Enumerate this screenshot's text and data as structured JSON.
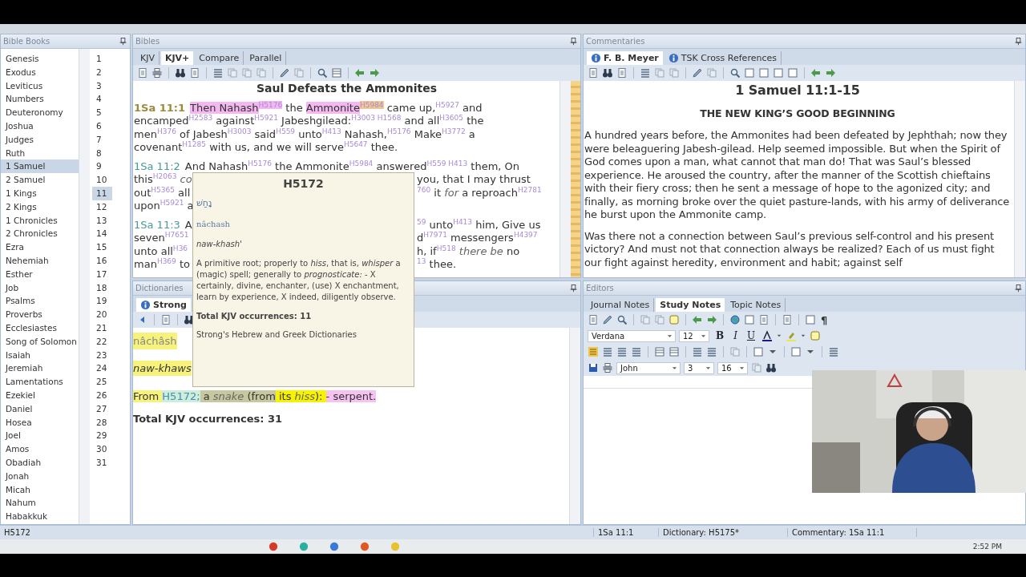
{
  "bible_books": {
    "title": "Bible Books",
    "books": [
      {
        "label": "Genesis",
        "selected": false
      },
      {
        "label": "Exodus",
        "selected": false
      },
      {
        "label": "Leviticus",
        "selected": false
      },
      {
        "label": "Numbers",
        "selected": false
      },
      {
        "label": "Deuteronomy",
        "selected": false
      },
      {
        "label": "Joshua",
        "selected": false
      },
      {
        "label": "Judges",
        "selected": false
      },
      {
        "label": "Ruth",
        "selected": false
      },
      {
        "label": "1 Samuel",
        "selected": true
      },
      {
        "label": "2 Samuel",
        "selected": false
      },
      {
        "label": "1 Kings",
        "selected": false
      },
      {
        "label": "2 Kings",
        "selected": false
      },
      {
        "label": "1 Chronicles",
        "selected": false
      },
      {
        "label": "2 Chronicles",
        "selected": false
      },
      {
        "label": "Ezra",
        "selected": false
      },
      {
        "label": "Nehemiah",
        "selected": false
      },
      {
        "label": "Esther",
        "selected": false
      },
      {
        "label": "Job",
        "selected": false
      },
      {
        "label": "Psalms",
        "selected": false
      },
      {
        "label": "Proverbs",
        "selected": false
      },
      {
        "label": "Ecclesiastes",
        "selected": false
      },
      {
        "label": "Song of Solomon",
        "selected": false
      },
      {
        "label": "Isaiah",
        "selected": false
      },
      {
        "label": "Jeremiah",
        "selected": false
      },
      {
        "label": "Lamentations",
        "selected": false
      },
      {
        "label": "Ezekiel",
        "selected": false
      },
      {
        "label": "Daniel",
        "selected": false
      },
      {
        "label": "Hosea",
        "selected": false
      },
      {
        "label": "Joel",
        "selected": false
      },
      {
        "label": "Amos",
        "selected": false
      },
      {
        "label": "Obadiah",
        "selected": false
      },
      {
        "label": "Jonah",
        "selected": false
      },
      {
        "label": "Micah",
        "selected": false
      },
      {
        "label": "Nahum",
        "selected": false
      },
      {
        "label": "Habakkuk",
        "selected": false
      }
    ],
    "chapters": [
      {
        "label": "1",
        "selected": false
      },
      {
        "label": "2",
        "selected": false
      },
      {
        "label": "3",
        "selected": false
      },
      {
        "label": "4",
        "selected": false
      },
      {
        "label": "5",
        "selected": false
      },
      {
        "label": "6",
        "selected": false
      },
      {
        "label": "7",
        "selected": false
      },
      {
        "label": "8",
        "selected": false
      },
      {
        "label": "9",
        "selected": false
      },
      {
        "label": "10",
        "selected": false
      },
      {
        "label": "11",
        "selected": true
      },
      {
        "label": "12",
        "selected": false
      },
      {
        "label": "13",
        "selected": false
      },
      {
        "label": "14",
        "selected": false
      },
      {
        "label": "15",
        "selected": false
      },
      {
        "label": "16",
        "selected": false
      },
      {
        "label": "17",
        "selected": false
      },
      {
        "label": "18",
        "selected": false
      },
      {
        "label": "19",
        "selected": false
      },
      {
        "label": "20",
        "selected": false
      },
      {
        "label": "21",
        "selected": false
      },
      {
        "label": "22",
        "selected": false
      },
      {
        "label": "23",
        "selected": false
      },
      {
        "label": "24",
        "selected": false
      },
      {
        "label": "25",
        "selected": false
      },
      {
        "label": "26",
        "selected": false
      },
      {
        "label": "27",
        "selected": false
      },
      {
        "label": "28",
        "selected": false
      },
      {
        "label": "29",
        "selected": false
      },
      {
        "label": "30",
        "selected": false
      },
      {
        "label": "31",
        "selected": false
      }
    ]
  },
  "bibles": {
    "title": "Bibles",
    "tabs": [
      {
        "label": "KJV",
        "selected": false
      },
      {
        "label": "KJV+",
        "selected": true
      },
      {
        "label": "Compare",
        "selected": false
      },
      {
        "label": "Parallel",
        "selected": false
      }
    ],
    "heading": "Saul Defeats the Ammonites",
    "verses": [
      {
        "reference": "1Sa 11:1",
        "selected": true,
        "lines": [
          {
            "runs": [
              {
                "t": "Then Nahash",
                "color": "#f4b8f0"
              },
              {
                "t": "H5176",
                "kind": "superscript",
                "color": "#f4b8f0"
              },
              {
                "t": " the "
              },
              {
                "t": "Ammonite",
                "color": "#f4b8f0"
              },
              {
                "t": "H5984",
                "kind": "superscript",
                "color": "#f0c890"
              },
              {
                "t": " came up,"
              },
              {
                "t": "H5927",
                "kind": "superscript"
              },
              {
                "t": " and"
              }
            ]
          },
          {
            "runs": [
              {
                "t": "encamped"
              },
              {
                "t": "H2583",
                "kind": "superscript"
              },
              {
                "t": " against"
              },
              {
                "t": "H5921",
                "kind": "superscript"
              },
              {
                "t": " Jabeshgilead:"
              },
              {
                "t": "H3003 H1568",
                "kind": "superscript"
              },
              {
                "t": " and all"
              },
              {
                "t": "H3605",
                "kind": "superscript"
              },
              {
                "t": " the"
              }
            ]
          },
          {
            "runs": [
              {
                "t": "men"
              },
              {
                "t": "H376",
                "kind": "superscript"
              },
              {
                "t": " of Jabesh"
              },
              {
                "t": "H3003",
                "kind": "superscript"
              },
              {
                "t": " said"
              },
              {
                "t": "H559",
                "kind": "superscript"
              },
              {
                "t": " unto"
              },
              {
                "t": "H413",
                "kind": "superscript"
              },
              {
                "t": " Nahash,"
              },
              {
                "t": "H5176",
                "kind": "superscript"
              },
              {
                "t": " Make"
              },
              {
                "t": "H3772",
                "kind": "superscript"
              },
              {
                "t": " a"
              }
            ]
          },
          {
            "runs": [
              {
                "t": "covenant"
              },
              {
                "t": "H1285",
                "kind": "superscript"
              },
              {
                "t": " with us, and we will serve"
              },
              {
                "t": "H5647",
                "kind": "superscript"
              },
              {
                "t": " thee."
              }
            ]
          }
        ]
      },
      {
        "reference": "1Sa 11:2",
        "selected": false,
        "lines": [
          {
            "runs": [
              {
                "t": "And Nahash"
              },
              {
                "t": "H5176",
                "kind": "superscript"
              },
              {
                "t": " the Ammonite"
              },
              {
                "t": "H5984",
                "kind": "superscript"
              },
              {
                "t": " answered"
              },
              {
                "t": "H559 H413",
                "kind": "superscript"
              },
              {
                "t": " them, On"
              }
            ]
          },
          {
            "runs": [
              {
                "t": "this"
              },
              {
                "t": "H2063",
                "kind": "superscript"
              },
              {
                "t": " co",
                "kind": "italic"
              }
            ],
            "runs_right": [
              {
                "t": "you, that I may thrust"
              }
            ]
          },
          {
            "runs": [
              {
                "t": "out"
              },
              {
                "t": "H5365",
                "kind": "superscript"
              },
              {
                "t": " all"
              }
            ],
            "runs_right": [
              {
                "t": "760",
                "kind": "superscript"
              },
              {
                "t": " it "
              },
              {
                "t": "for",
                "kind": "italic"
              },
              {
                "t": " a reproach"
              },
              {
                "t": "H2781",
                "kind": "superscript"
              }
            ]
          },
          {
            "runs": [
              {
                "t": "upon"
              },
              {
                "t": "H5921",
                "kind": "superscript"
              },
              {
                "t": " a"
              }
            ]
          }
        ]
      },
      {
        "reference": "1Sa 11:3",
        "selected": false,
        "lines": [
          {
            "runs": [
              {
                "t": "A"
              }
            ],
            "runs_right": [
              {
                "t": "59",
                "kind": "superscript"
              },
              {
                "t": " unto"
              },
              {
                "t": "H413",
                "kind": "superscript"
              },
              {
                "t": " him, Give us"
              }
            ]
          },
          {
            "runs": [
              {
                "t": "seven"
              },
              {
                "t": "H7651",
                "kind": "superscript"
              }
            ],
            "runs_right": [
              {
                "t": "d"
              },
              {
                "t": "H7971",
                "kind": "superscript"
              },
              {
                "t": " messengers"
              },
              {
                "t": "H4397",
                "kind": "superscript"
              }
            ]
          },
          {
            "runs": [
              {
                "t": "unto all"
              },
              {
                "t": "H36",
                "kind": "superscript"
              }
            ],
            "runs_right": [
              {
                "t": "h, if"
              },
              {
                "t": "H518",
                "kind": "superscript"
              },
              {
                "t": " there be",
                "kind": "italic"
              },
              {
                "t": " no"
              }
            ]
          },
          {
            "runs": [
              {
                "t": "man"
              },
              {
                "t": "H369",
                "kind": "superscript"
              },
              {
                "t": " to"
              }
            ],
            "runs_right": [
              {
                "t": "13",
                "kind": "superscript"
              },
              {
                "t": " thee."
              }
            ]
          }
        ]
      }
    ]
  },
  "popup": {
    "title": "H5172",
    "hebrew": "נָחַשׁ",
    "transliteration": "nâchash",
    "pronunciation": "naw-khash'",
    "definition": "A primitive root; properly to *hiss*, that is, *whisper* a (magic) spell; generally to *prognosticate:* - X certainly, divine, enchanter, (use) X enchantment, learn by experience, X indeed, diligently observe.",
    "occurrences": "Total KJV occurrences: 11",
    "source": "Strong's Hebrew and Greek Dictionaries"
  },
  "dictionaries": {
    "title": "Dictionaries",
    "tabs": [
      {
        "label": "Strong",
        "selected": true
      }
    ],
    "word": {
      "text": "nâchâsh",
      "color": "#f6f27c"
    },
    "pronunciation": {
      "text": "naw-khaws",
      "color": "#f6f27c"
    },
    "definition": [
      {
        "t": "From ",
        "color": "#f6f27c"
      },
      {
        "t": "H5172;",
        "kind": "link",
        "color": "#cdeed8"
      },
      {
        "t": " a ",
        "color": "#c8c8a0"
      },
      {
        "t": "snake",
        "kind": "italic",
        "color": "#c8c8a0"
      },
      {
        "t": " (from",
        "color": "#c8c8a0"
      },
      {
        "t": " its ",
        "color": "#f6f200"
      },
      {
        "t": "hiss",
        "kind": "italic",
        "color": "#f6f200"
      },
      {
        "t": "): ",
        "color": "#f6f200"
      },
      {
        "t": "- serpent.",
        "color": "#f6c2f0"
      }
    ],
    "occurrences": "Total KJV occurrences: 31"
  },
  "commentaries": {
    "title": "Commentaries",
    "tabs": [
      {
        "label": "F. B. Meyer",
        "selected": true
      },
      {
        "label": "TSK Cross References",
        "selected": false
      }
    ],
    "heading": "1 Samuel 11:1-15",
    "subheading": "THE NEW KING’S GOOD BEGINNING",
    "paragraphs": [
      "A hundred years before, the Ammonites had been defeated by Jephthah; now they were beleaguering Jabesh-gilead. Help seemed impossible. But when the Spirit of God comes upon a man, what cannot that man do! That was Saul’s blessed experience. He aroused the country, after the manner of the Scottish chieftains with their fiery cross; then he sent a message of hope to the agonized city; and finally, as morning broke over the quiet pasture-lands, with his army of deliverance he burst upon the Ammonite camp.",
      "Was there not a connection between Saul’s previous self-control and his present victory? And must not that connection always be realized? Each of us must fight our fight against heredity, environment and habit; against self"
    ]
  },
  "editors": {
    "title": "Editors",
    "tabs": [
      {
        "label": "Journal Notes",
        "selected": false
      },
      {
        "label": "Study Notes",
        "selected": true
      },
      {
        "label": "Topic Notes",
        "selected": false
      }
    ],
    "paragraph_mark": "¶",
    "font": "Verdana",
    "font_size": "12",
    "format_buttons": [
      "B",
      "I",
      "U"
    ],
    "book": "John",
    "chapter": "3",
    "verse": "16"
  },
  "status_bar": [
    "H5172",
    "1Sa 11:1",
    "Dictionary: H5175*",
    "Commentary: 1Sa 11:1"
  ],
  "taskbar": {
    "time": "2:52 PM"
  }
}
